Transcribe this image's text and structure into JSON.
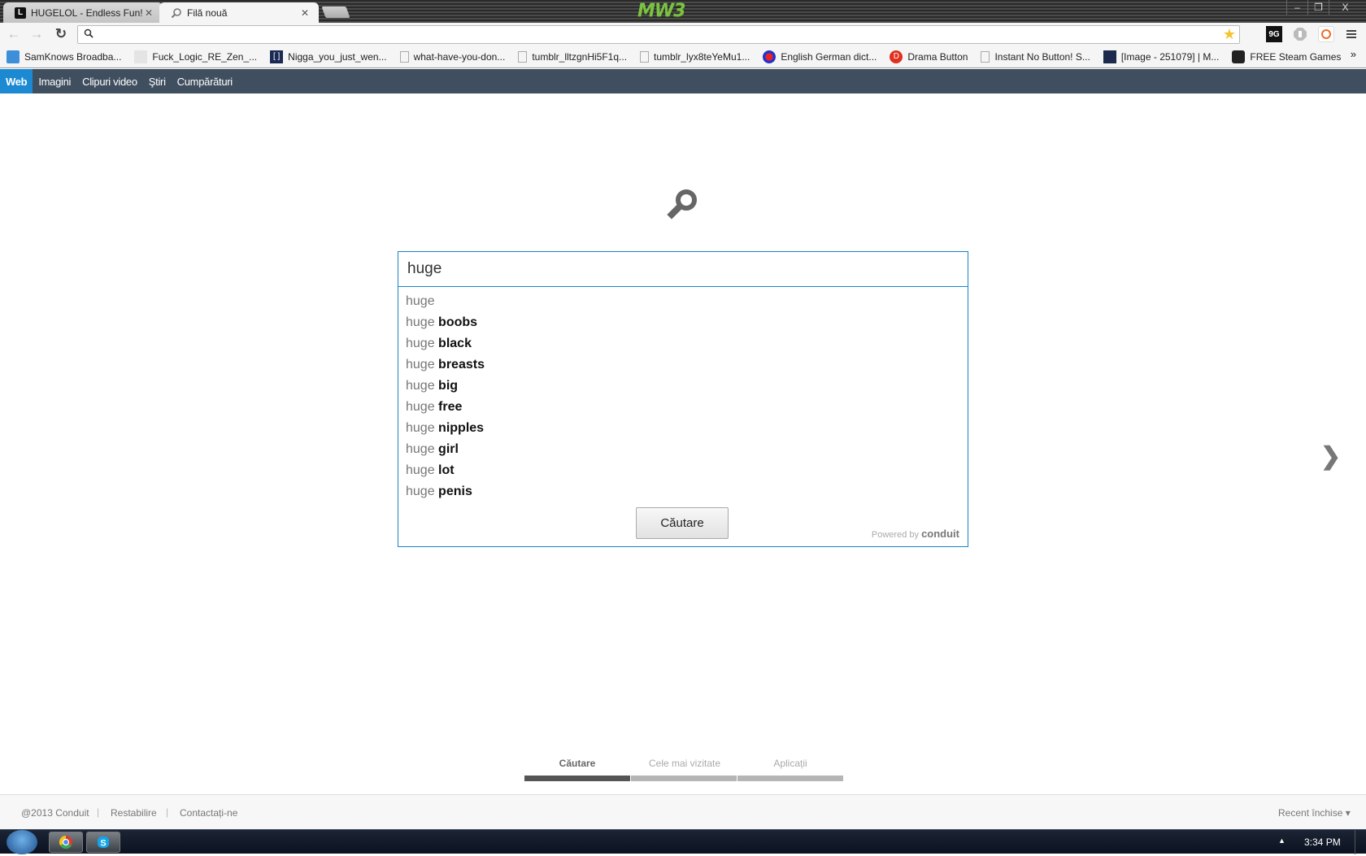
{
  "window": {
    "tabs": [
      {
        "title": "HUGELOL - Endless Fun!",
        "favicon": "L",
        "active": false
      },
      {
        "title": "Filă nouă",
        "favicon": "search-icon",
        "active": true
      }
    ],
    "theme_logo": "MW3",
    "controls": {
      "minimize": "‒",
      "restore": "❐",
      "close": "X"
    }
  },
  "toolbar": {
    "back": "←",
    "forward": "→",
    "reload": "↻",
    "omnibox_value": "",
    "extensions": [
      "9G",
      "hand-stop",
      "ring"
    ]
  },
  "bookmarks": [
    {
      "label": "SamKnows Broadba...",
      "icon": "chat-bubble-icon"
    },
    {
      "label": "Fuck_Logic_RE_Zen_...",
      "icon": "image-icon"
    },
    {
      "label": "Nigga_you_just_wen...",
      "icon": "bracket-icon"
    },
    {
      "label": "what-have-you-don...",
      "icon": "page-icon"
    },
    {
      "label": "tumblr_lltzgnHi5F1q...",
      "icon": "page-icon"
    },
    {
      "label": "tumblr_lyx8teYeMu1...",
      "icon": "page-icon"
    },
    {
      "label": "English German dict...",
      "icon": "dict-icon"
    },
    {
      "label": "Drama Button",
      "icon": "drama-icon"
    },
    {
      "label": "Instant No Button! S...",
      "icon": "page-icon"
    },
    {
      "label": "[Image - 251079] | M...",
      "icon": "kym-icon"
    },
    {
      "label": "FREE Steam Games",
      "icon": "steam-icon"
    }
  ],
  "bookmarks_more": "»",
  "conduit_nav": [
    {
      "label": "Web",
      "active": true
    },
    {
      "label": "Imagini",
      "active": false
    },
    {
      "label": "Clipuri video",
      "active": false
    },
    {
      "label": "Ştiri",
      "active": false
    },
    {
      "label": "Cumpărături",
      "active": false
    }
  ],
  "search": {
    "query": "huge",
    "suggestions": [
      {
        "prefix": "huge",
        "suffix": ""
      },
      {
        "prefix": "huge",
        "suffix": "boobs"
      },
      {
        "prefix": "huge",
        "suffix": "black"
      },
      {
        "prefix": "huge",
        "suffix": "breasts"
      },
      {
        "prefix": "huge",
        "suffix": "big"
      },
      {
        "prefix": "huge",
        "suffix": "free"
      },
      {
        "prefix": "huge",
        "suffix": "nipples"
      },
      {
        "prefix": "huge",
        "suffix": "girl"
      },
      {
        "prefix": "huge",
        "suffix": "lot"
      },
      {
        "prefix": "huge",
        "suffix": "penis"
      }
    ],
    "button_label": "Căutare",
    "powered_by": "Powered by",
    "powered_brand": "conduit"
  },
  "next_arrow": "❯",
  "bottom_tabs": [
    {
      "label": "Căutare",
      "active": true
    },
    {
      "label": "Cele mai vizitate",
      "active": false
    },
    {
      "label": "Aplicații",
      "active": false
    }
  ],
  "footer": {
    "copyright": "@2013 Conduit",
    "restore": "Restabilire",
    "contact": "Contactați-ne",
    "recently_closed": "Recent închise ▾",
    "separator": "|"
  },
  "taskbar": {
    "clock": "3:34 PM",
    "tray_arrow": "▲",
    "apps": [
      "chrome",
      "skype"
    ]
  },
  "colors": {
    "accent": "#1a83c6",
    "nav_bg": "#3f4f5f",
    "nav_active": "#1b8ad3",
    "logo_green": "#7cc242"
  }
}
